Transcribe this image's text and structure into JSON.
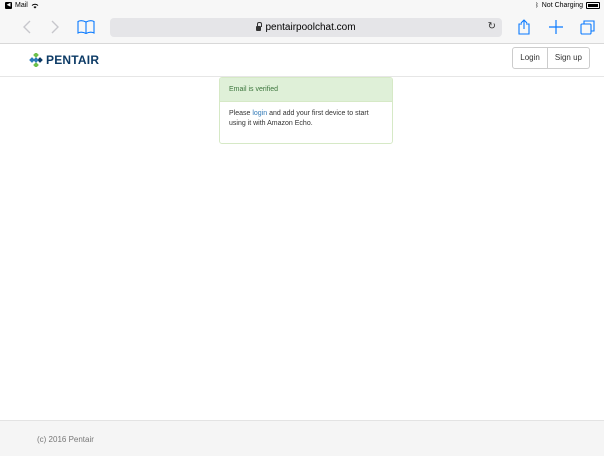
{
  "status_bar": {
    "back_app": "Mail",
    "charging_text": "Not Charging"
  },
  "browser": {
    "url": "pentairpoolchat.com",
    "icons": [
      "chevron-left-icon",
      "chevron-right-icon",
      "bookmarks-icon",
      "lock-icon",
      "reload-icon",
      "share-icon",
      "plus-icon",
      "tabs-icon"
    ]
  },
  "header": {
    "brand": "PENTAIR",
    "login_label": "Login",
    "signup_label": "Sign up"
  },
  "alert": {
    "title": "Email is verified",
    "text_before": "Please ",
    "link_text": "login",
    "text_after": " and add your first device to start using it with Amazon Echo."
  },
  "footer": {
    "copyright": "(c) 2016 Pentair"
  },
  "colors": {
    "brand": "#0d3b66",
    "success_bg": "#dff0d8",
    "success_text": "#3c763d",
    "link": "#337ab7",
    "ios_blue": "#0a7aff"
  }
}
